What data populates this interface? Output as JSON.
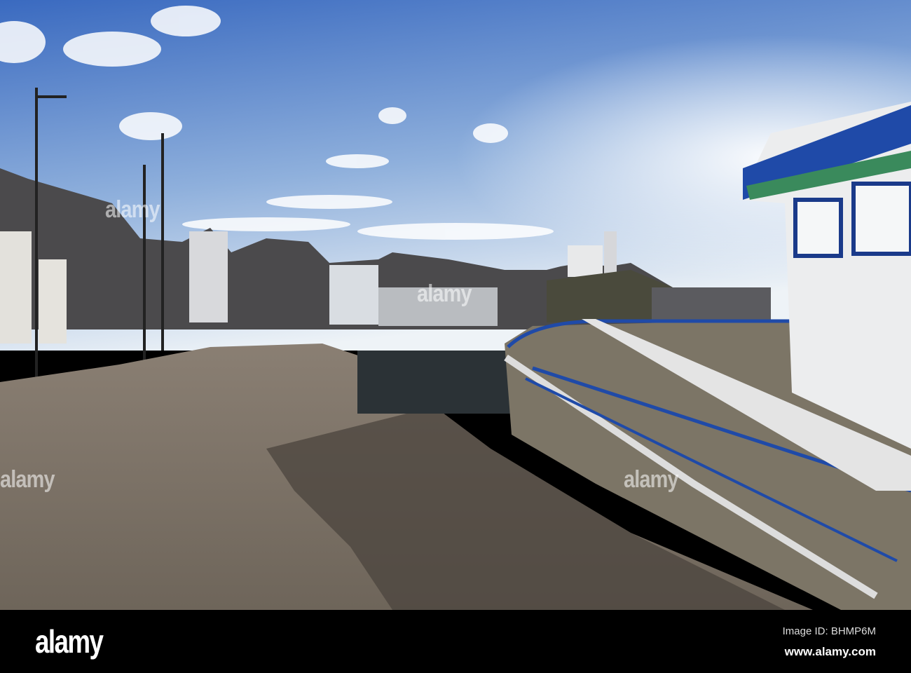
{
  "watermark": {
    "text": "alamy"
  },
  "footer": {
    "logo": "alamy",
    "image_id": "Image ID: BHMP6M",
    "url": "www.alamy.com"
  },
  "colors": {
    "sky_top": "#3f6fc0",
    "sky_horizon": "#e9f0f6",
    "pavement": "#7c7165",
    "boat_blue": "#1f4aa8"
  }
}
